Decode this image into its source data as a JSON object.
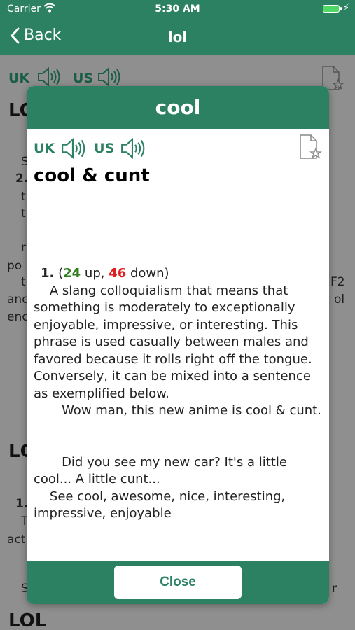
{
  "status_bar": {
    "carrier": "Carrier",
    "time": "5:30 AM"
  },
  "nav": {
    "back_label": "Back",
    "title": "lol"
  },
  "background": {
    "uk": "UK",
    "us": "US",
    "heading_1": "LO",
    "item_2": "2.",
    "frag_s": "S",
    "frag_t1": "t",
    "frag_t2": "t",
    "frag_r": "r",
    "frag_po": "po",
    "frag_t3": "t",
    "frag_f2": "F2",
    "frag_and": "and",
    "frag_ool": "ol",
    "frag_enc": "enc",
    "heading_2": "LC",
    "item_1": "1.",
    "frag_T": "T",
    "frag_act": "act",
    "frag_s2": "S",
    "frag_r2": "r",
    "heading_3": "LOL"
  },
  "modal": {
    "title": "cool",
    "uk": "UK",
    "us": "US",
    "word": "cool & cunt",
    "definition": {
      "number": "1.",
      "open_paren": " (",
      "up_count": "24",
      "up_text": " up, ",
      "down_count": "46",
      "down_text": " down)",
      "text": "    A slang colloquialism that means that something is moderately to exceptionally enjoyable, impressive, or interesting. This phrase is used casually between males and favored because it rolls right off the tongue. Conversely, it can be mixed into a sentence as exemplified below.\n       Wow man, this new anime is cool & cunt.\n\n\n       Did you see my new car? It's a little cool... A little cunt...\n    See cool, awesome, nice, interesting, impressive, enjoyable"
    },
    "close_label": "Close"
  },
  "colors": {
    "primary": "#2c8163",
    "up": "#2e7d1e",
    "down": "#e02020"
  },
  "icons": [
    "wifi-icon",
    "battery-icon",
    "back-chevron-icon",
    "speaker-icon",
    "favorite-document-icon"
  ]
}
